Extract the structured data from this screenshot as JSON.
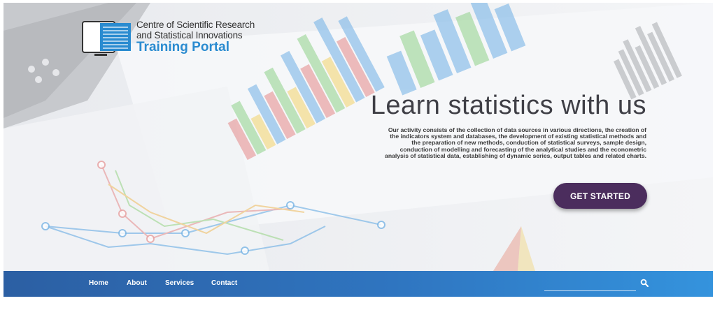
{
  "logo": {
    "line1": "Centre of Scientific Research",
    "line2": "and Statistical Innovations",
    "line3": "Training Portal"
  },
  "hero": {
    "headline": "Learn statistics with us",
    "description": "Our activity consists of the collection of data sources in various directions, the creation of the indicators system and databases, the development of existing statistical methods and the preparation of new methods, conduction of statistical surveys, sample design, conduction of modelling and forecasting of the analytical studies and the econometric analysis of statistical data, establishing of dynamic series, output tables and related charts.",
    "cta_label": "GET STARTED"
  },
  "nav": {
    "items": [
      "Home",
      "About",
      "Services",
      "Contact"
    ]
  },
  "search": {
    "placeholder": "",
    "icon": "search-icon"
  },
  "colors": {
    "accent": "#2a8bd0",
    "cta": "#4b2d5d",
    "nav_start": "#2c5fa3",
    "nav_end": "#3493dd"
  }
}
